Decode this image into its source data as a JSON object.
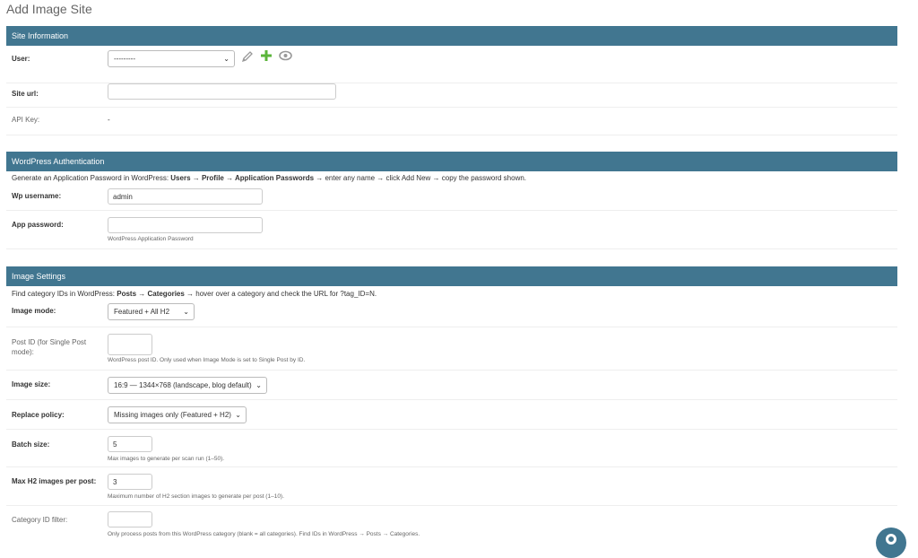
{
  "page": {
    "title": "Add Image Site"
  },
  "site_information": {
    "header": "Site Information",
    "user": {
      "label": "User:",
      "selected": "---------"
    },
    "site_url": {
      "label": "Site url:",
      "value": ""
    },
    "api_key": {
      "label": "API Key:",
      "value": "-"
    },
    "icons": [
      "pencil-icon",
      "plus-icon",
      "eye-icon"
    ]
  },
  "wordpress_auth": {
    "header": "WordPress Authentication",
    "desc_prefix": "Generate an Application Password in WordPress: ",
    "desc_path": "Users → Profile → Application Passwords",
    "desc_suffix": " → enter any name → click Add New → copy the password shown.",
    "wp_username": {
      "label": "Wp username:",
      "value": "admin"
    },
    "app_password": {
      "label": "App password:",
      "value": "",
      "help": "WordPress Application Password"
    }
  },
  "image_settings": {
    "header": "Image Settings",
    "desc_prefix": "Find category IDs in WordPress: ",
    "desc_path": "Posts → Categories",
    "desc_suffix": " → hover over a category and check the URL for ?tag_ID=N.",
    "image_mode": {
      "label": "Image mode:",
      "selected": "Featured + All H2"
    },
    "post_id": {
      "label_line1": "Post ID (for Single Post",
      "label_line2": "mode):",
      "value": "",
      "help": "WordPress post ID. Only used when Image Mode is set to Single Post by ID."
    },
    "image_size": {
      "label": "Image size:",
      "selected": "16:9 — 1344×768 (landscape, blog default)"
    },
    "replace_policy": {
      "label": "Replace policy:",
      "selected": "Missing images only (Featured + H2)"
    },
    "batch_size": {
      "label": "Batch size:",
      "value": "5",
      "help": "Max images to generate per scan run (1–50)."
    },
    "max_h2": {
      "label": "Max H2 images per post:",
      "value": "3",
      "help": "Maximum number of H2 section images to generate per post (1–10)."
    },
    "category_filter": {
      "label": "Category ID filter:",
      "value": "",
      "help": "Only process posts from this WordPress category (blank = all categories). Find IDs in WordPress → Posts → Categories."
    }
  },
  "colors": {
    "header_bg": "#417690",
    "add_green": "#5bb53b",
    "icon_gray": "#999999"
  }
}
